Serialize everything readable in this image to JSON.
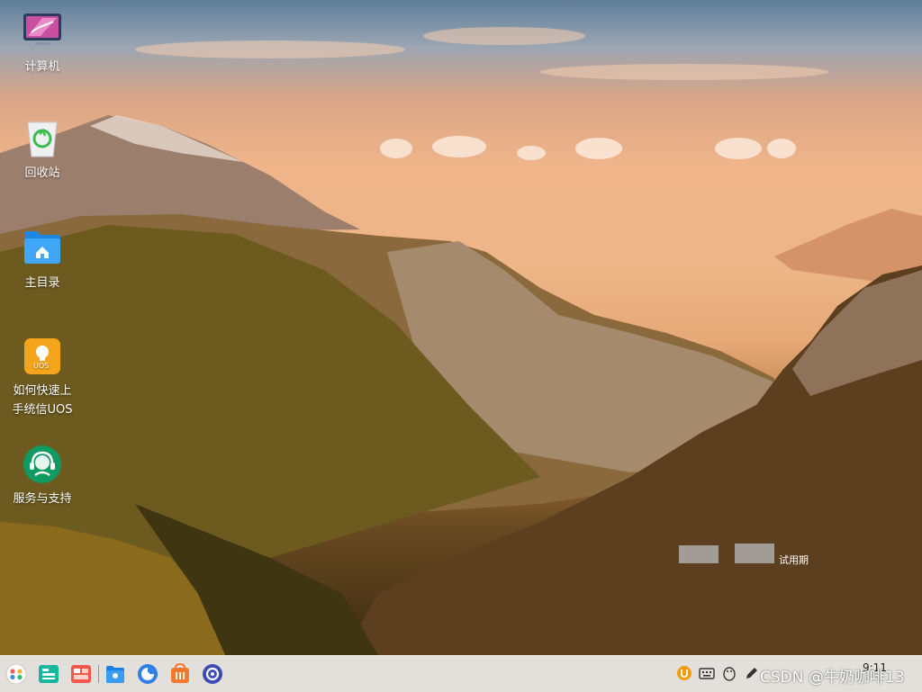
{
  "desktop": {
    "icons": [
      {
        "label": "计算机",
        "icon": "computer-icon"
      },
      {
        "label": "回收站",
        "icon": "trash-icon"
      },
      {
        "label": "主目录",
        "icon": "home-folder-icon"
      },
      {
        "label_line1": "如何快速上",
        "label_line2": "手统信UOS",
        "icon": "uos-guide-icon",
        "badge": "UOS"
      },
      {
        "label": "服务与支持",
        "icon": "support-icon"
      }
    ],
    "watermark": {
      "text": "试用期"
    }
  },
  "taskbar": {
    "apps": [
      "launcher-icon",
      "multitask-view-icon",
      "desktop-view-icon",
      "file-manager-icon",
      "browser-icon",
      "app-store-icon",
      "settings-icon"
    ],
    "tray": [
      "uos-id-icon",
      "keyboard-icon",
      "penguin-icon",
      "pen-icon"
    ],
    "clock": "9:11"
  },
  "overlay": {
    "text": "CSDN @牛奶咖啡13"
  },
  "colors": {
    "taskbar": "#e1ded8",
    "accent_blue": "#2b8fe8",
    "sky_orange": "#efb48a"
  }
}
